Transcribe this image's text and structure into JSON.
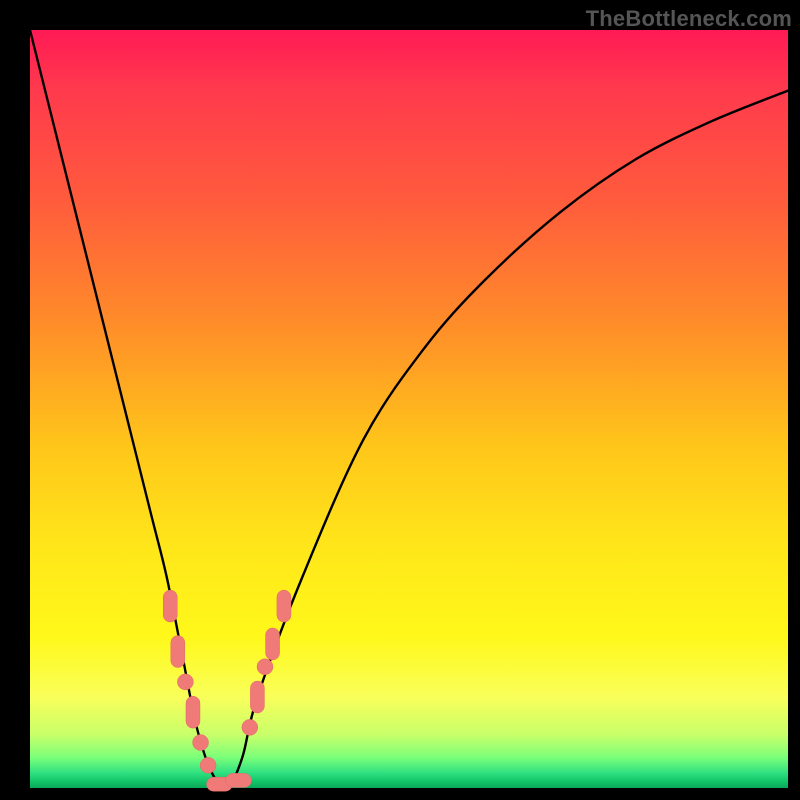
{
  "watermark": "TheBottleneck.com",
  "colors": {
    "frame": "#000000",
    "watermark": "#555555",
    "curve": "#000000",
    "marker": "#ef7a78",
    "gradient_stops": [
      "#ff1a55",
      "#ff3a4d",
      "#ff5a3d",
      "#ff8a2a",
      "#ffc61a",
      "#ffe61a",
      "#fff81a",
      "#f9ff5a",
      "#c8ff6a",
      "#7aff7a",
      "#30e080",
      "#15c86a",
      "#0aa85a"
    ]
  },
  "chart_data": {
    "type": "line",
    "title": "",
    "xlabel": "",
    "ylabel": "",
    "xlim": [
      0,
      100
    ],
    "ylim": [
      0,
      100
    ],
    "series": [
      {
        "name": "bottleneck-curve",
        "x": [
          0,
          4,
          8,
          12,
          16,
          18,
          20,
          22,
          24,
          26,
          28,
          30,
          36,
          44,
          52,
          60,
          70,
          80,
          90,
          100
        ],
        "values": [
          100,
          84,
          68,
          52,
          36,
          28,
          18,
          8,
          2,
          0,
          4,
          12,
          28,
          46,
          58,
          67,
          76,
          83,
          88,
          92
        ]
      }
    ],
    "markers_left": [
      {
        "x": 18.5,
        "y": 24,
        "shape": "pill-vertical"
      },
      {
        "x": 19.5,
        "y": 18,
        "shape": "pill-vertical"
      },
      {
        "x": 20.5,
        "y": 14,
        "shape": "dot"
      },
      {
        "x": 21.5,
        "y": 10,
        "shape": "pill-vertical"
      },
      {
        "x": 22.5,
        "y": 6,
        "shape": "dot"
      },
      {
        "x": 23.5,
        "y": 3,
        "shape": "dot"
      }
    ],
    "markers_bottom": [
      {
        "x": 25.0,
        "y": 0.5,
        "shape": "pill-horizontal"
      },
      {
        "x": 27.5,
        "y": 1.0,
        "shape": "pill-horizontal"
      }
    ],
    "markers_right": [
      {
        "x": 29.0,
        "y": 8,
        "shape": "dot"
      },
      {
        "x": 30.0,
        "y": 12,
        "shape": "pill-vertical"
      },
      {
        "x": 31.0,
        "y": 16,
        "shape": "dot"
      },
      {
        "x": 32.0,
        "y": 19,
        "shape": "pill-vertical"
      },
      {
        "x": 33.5,
        "y": 24,
        "shape": "pill-vertical"
      }
    ]
  }
}
